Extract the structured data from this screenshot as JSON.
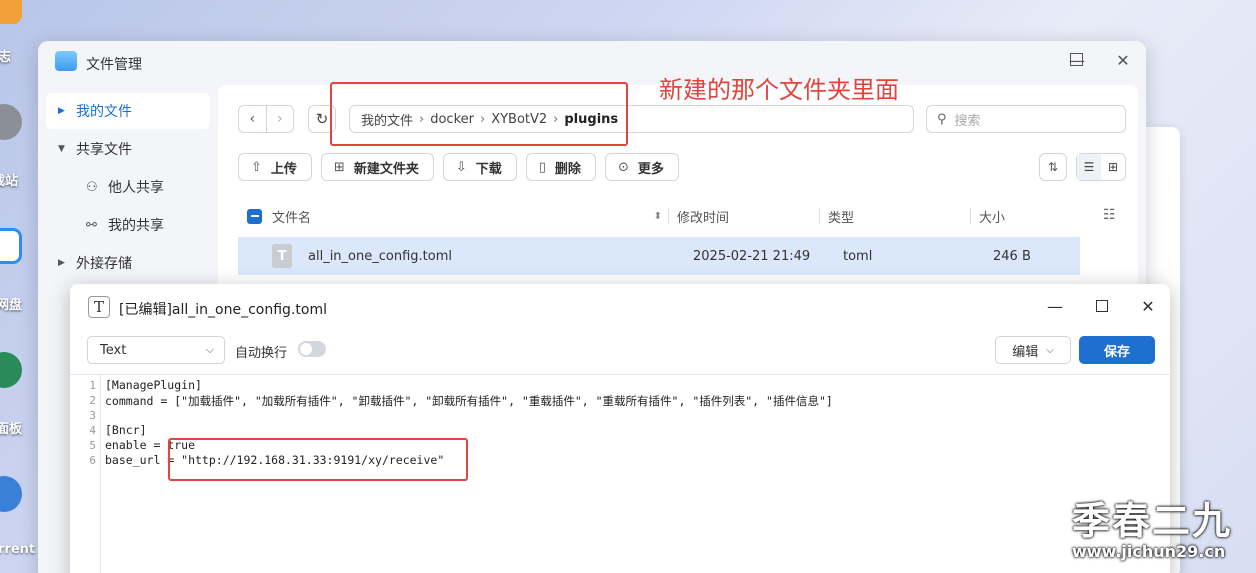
{
  "desktop": {
    "labels": [
      "志",
      "载站",
      "网盘",
      "面板",
      "rrent"
    ]
  },
  "file_manager": {
    "title": "文件管理",
    "sidebar": {
      "items": [
        {
          "label": "我的文件",
          "active": true
        },
        {
          "label": "共享文件",
          "expanded": true
        },
        {
          "label": "他人共享",
          "sub": true
        },
        {
          "label": "我的共享",
          "sub": true
        },
        {
          "label": "外接存储"
        }
      ]
    },
    "breadcrumb": [
      "我的文件",
      "docker",
      "XYBotV2",
      "plugins"
    ],
    "search_placeholder": "搜索",
    "toolbar": {
      "upload": "上传",
      "new_folder": "新建文件夹",
      "download": "下载",
      "delete": "删除",
      "more": "更多"
    },
    "columns": {
      "name": "文件名",
      "modified": "修改时间",
      "type": "类型",
      "size": "大小"
    },
    "rows": [
      {
        "name": "all_in_one_config.toml",
        "modified": "2025-02-21 21:49",
        "type": "toml",
        "size": "246 B"
      }
    ]
  },
  "annotation_text": "新建的那个文件夹里面",
  "editor": {
    "title": "[已编辑]all_in_one_config.toml",
    "syntax": "Text",
    "wrap_label": "自动换行",
    "edit_label": "编辑",
    "save_label": "保存",
    "lines": [
      "[ManagePlugin]",
      "command = [\"加载插件\", \"加载所有插件\", \"卸载插件\", \"卸载所有插件\", \"重载插件\", \"重载所有插件\", \"插件列表\", \"插件信息\"]",
      "",
      "[Bncr]",
      "enable = true",
      "base_url = \"http://192.168.31.33:9191/xy/receive\""
    ],
    "line_numbers": [
      "1",
      "2",
      "3",
      "4",
      "5",
      "6"
    ]
  },
  "watermark": {
    "big": "季春二九",
    "small": "www.jichun29.cn"
  }
}
